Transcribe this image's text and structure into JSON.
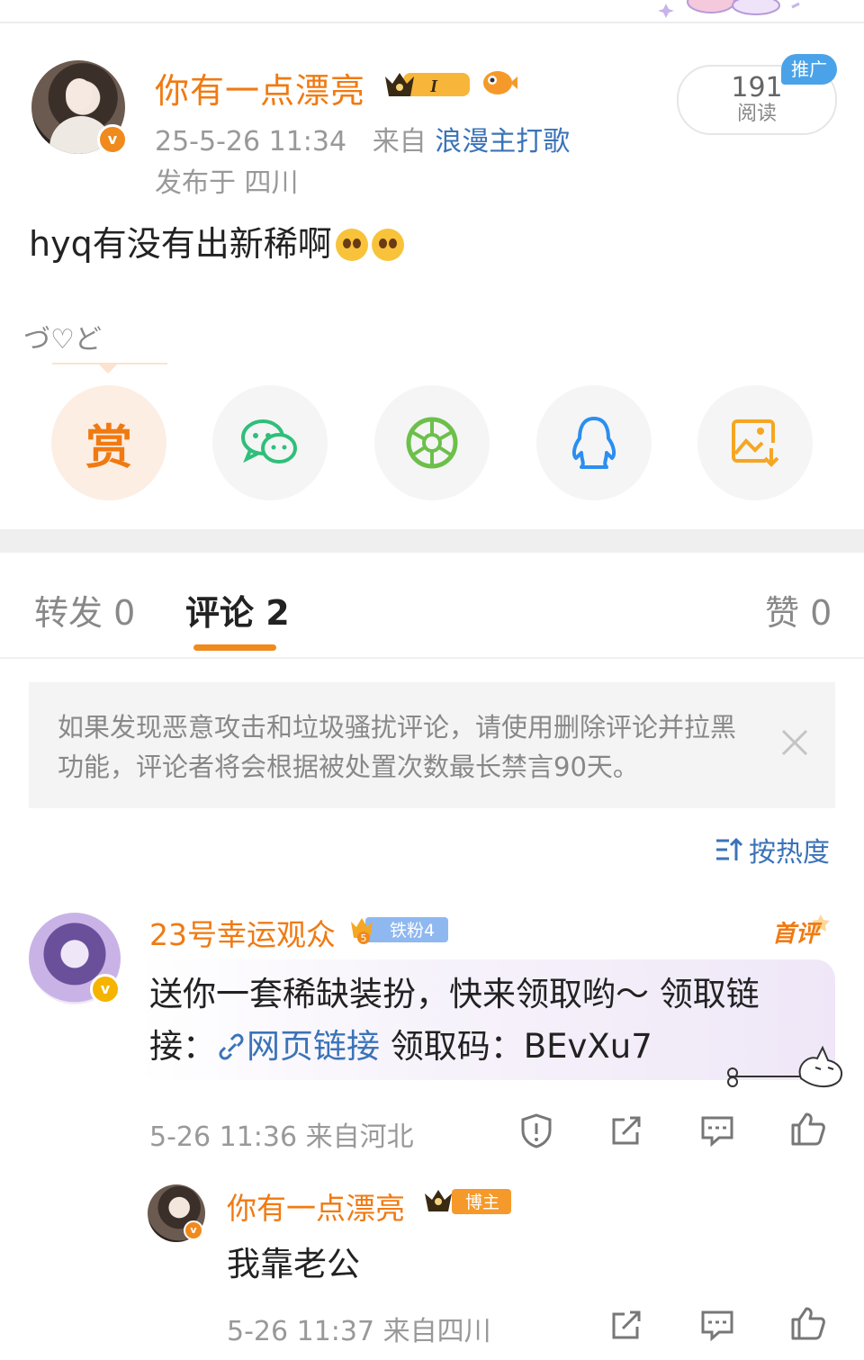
{
  "post": {
    "author": "你有一点漂亮",
    "level_badge": "I",
    "timestamp": "25-5-26 11:34",
    "from_label": "来自",
    "source": "浪漫主打歌",
    "location": "发布于 四川",
    "text": "hyq有没有出新稀啊",
    "read_count": "191",
    "read_label": "阅读",
    "promo": "推广",
    "decoration_text": "づ♡ど"
  },
  "share": {
    "reward_label": "赏",
    "buttons": [
      "reward-icon",
      "wechat-icon",
      "moments-icon",
      "qq-icon",
      "save-image-icon"
    ]
  },
  "tabs": {
    "repost": "转发 0",
    "comments": "评论 2",
    "likes": "赞 0"
  },
  "notice": {
    "text": "如果发现恶意攻击和垃圾骚扰评论，请使用删除评论并拉黑功能，评论者将会根据被处置次数最长禁言90天。"
  },
  "sort": {
    "label": "按热度"
  },
  "comments": [
    {
      "name": "23号幸运观众",
      "fan_badge": "铁粉4",
      "fan_level": "5",
      "first_badge": "首评",
      "text_before": "送你一套稀缺装扮，快来领取哟～ 领取链接：",
      "link_text": "网页链接",
      "text_after": " 领取码：BEvXu7",
      "time": "5-26 11:36",
      "location": "来自河北"
    },
    {
      "name": "你有一点漂亮",
      "owner_badge": "博主",
      "text": "我靠老公",
      "time": "5-26 11:37",
      "location": "来自四川"
    }
  ],
  "colors": {
    "accent": "#f07a12",
    "link": "#3b73b8",
    "muted": "#999999"
  }
}
